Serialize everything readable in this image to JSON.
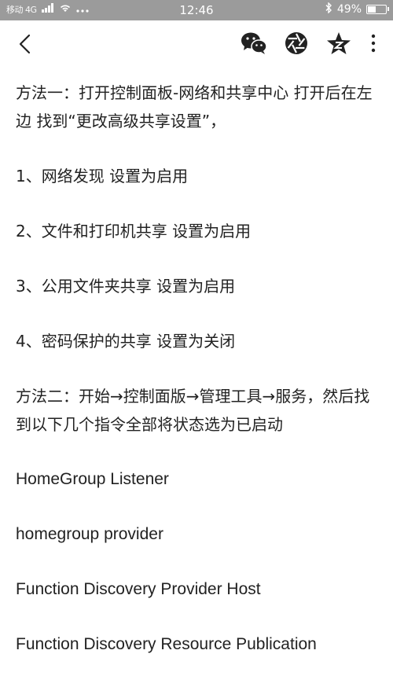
{
  "status_bar": {
    "carrier": "移动 4G",
    "time": "12:46",
    "battery_text": "49%",
    "battery_level": 0.49
  },
  "toolbar": {
    "back_icon": "chevron-left-icon",
    "wechat_icon": "wechat-icon",
    "moments_icon": "aperture-icon",
    "qzone_icon": "star-icon",
    "more_icon": "more-vertical-icon"
  },
  "content": {
    "paragraphs": [
      "方法一：打开控制面板-网络和共享中心 打开后在左边 找到“更改高级共享设置”，",
      "1、网络发现 设置为启用",
      "2、文件和打印机共享 设置为启用",
      "3、公用文件夹共享 设置为启用",
      "4、密码保护的共享 设置为关闭",
      "方法二：开始→控制面版→管理工具→服务，然后找到以下几个指令全部将状态选为已启动",
      "HomeGroup Listener",
      "homegroup provider",
      "Function Discovery Provider Host",
      "Function Discovery Resource Publication"
    ]
  }
}
